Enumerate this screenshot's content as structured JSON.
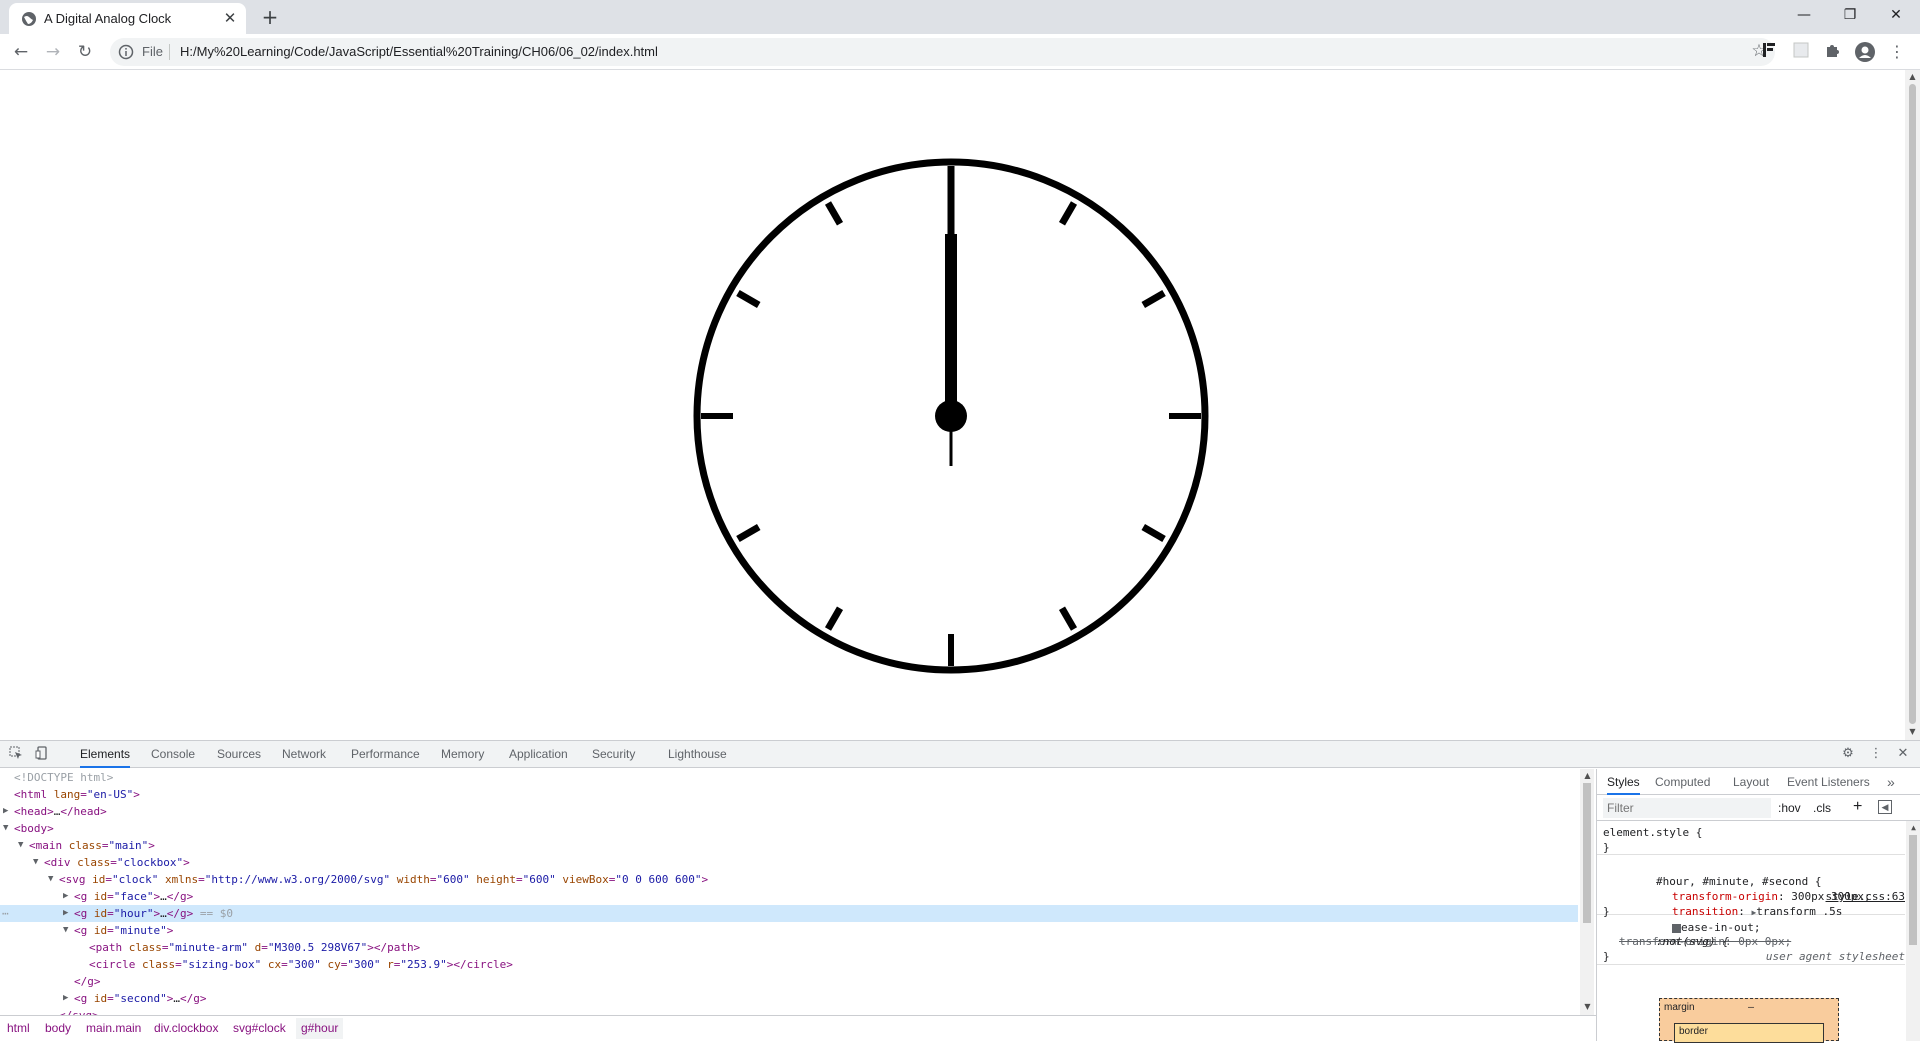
{
  "browser": {
    "tab_title": "A Digital Analog Clock",
    "new_tab_symbol": "+",
    "address_scheme": "File",
    "url": "H:/My%20Learning/Code/JavaScript/Essential%20Training/CH06/06_02/index.html"
  },
  "devtools": {
    "tabs": [
      "Elements",
      "Console",
      "Sources",
      "Network",
      "Performance",
      "Memory",
      "Application",
      "Security",
      "Lighthouse"
    ],
    "active_tab": "Elements",
    "dom_lines": [
      {
        "indent": 0,
        "html": "<span class='cm'>&lt;!DOCTYPE html&gt;</span>"
      },
      {
        "indent": 0,
        "html": "<span class='tg'>&lt;html</span> <span class='an'>lang</span><span class='tg'>=</span><span class='av'>\"en-US\"</span><span class='tg'>&gt;</span>"
      },
      {
        "indent": 0,
        "tri": "▶",
        "html": "<span class='tg'>&lt;head&gt;</span><span class='tx'>…</span><span class='tg'>&lt;/head&gt;</span>"
      },
      {
        "indent": 0,
        "tri": "▼",
        "html": "<span class='tg'>&lt;body&gt;</span>"
      },
      {
        "indent": 1,
        "tri": "▼",
        "html": "<span class='tg'>&lt;main</span> <span class='an'>class</span><span class='tg'>=</span><span class='av'>\"main\"</span><span class='tg'>&gt;</span>"
      },
      {
        "indent": 2,
        "tri": "▼",
        "html": "<span class='tg'>&lt;div</span> <span class='an'>class</span><span class='tg'>=</span><span class='av'>\"clockbox\"</span><span class='tg'>&gt;</span>"
      },
      {
        "indent": 3,
        "tri": "▼",
        "html": "<span class='tg'>&lt;svg</span> <span class='an'>id</span><span class='tg'>=</span><span class='av'>\"clock\"</span> <span class='an'>xmlns</span><span class='tg'>=</span><span class='av'>\"http://www.w3.org/2000/svg\"</span> <span class='an'>width</span><span class='tg'>=</span><span class='av'>\"600\"</span> <span class='an'>height</span><span class='tg'>=</span><span class='av'>\"600\"</span> <span class='an'>viewBox</span><span class='tg'>=</span><span class='av'>\"0 0 600 600\"</span><span class='tg'>&gt;</span>"
      },
      {
        "indent": 4,
        "tri": "▶",
        "html": "<span class='tg'>&lt;g</span> <span class='an'>id</span><span class='tg'>=</span><span class='av'>\"face\"</span><span class='tg'>&gt;</span><span class='tx'>…</span><span class='tg'>&lt;/g&gt;</span>"
      },
      {
        "indent": 4,
        "tri": "▶",
        "sel": true,
        "html": "<span class='tg'>&lt;g</span> <span class='an'>id</span><span class='tg'>=</span><span class='av'>\"hour\"</span><span class='tg'>&gt;</span><span class='tx'>…</span><span class='tg'>&lt;/g&gt;</span> <span class='cm'>== $0</span>"
      },
      {
        "indent": 4,
        "tri": "▼",
        "html": "<span class='tg'>&lt;g</span> <span class='an'>id</span><span class='tg'>=</span><span class='av'>\"minute\"</span><span class='tg'>&gt;</span>"
      },
      {
        "indent": 5,
        "html": "<span class='tg'>&lt;path</span> <span class='an'>class</span><span class='tg'>=</span><span class='av'>\"minute-arm\"</span> <span class='an'>d</span><span class='tg'>=</span><span class='av'>\"M300.5 298V67\"</span><span class='tg'>&gt;&lt;/path&gt;</span>"
      },
      {
        "indent": 5,
        "html": "<span class='tg'>&lt;circle</span> <span class='an'>class</span><span class='tg'>=</span><span class='av'>\"sizing-box\"</span> <span class='an'>cx</span><span class='tg'>=</span><span class='av'>\"300\"</span> <span class='an'>cy</span><span class='tg'>=</span><span class='av'>\"300\"</span> <span class='an'>r</span><span class='tg'>=</span><span class='av'>\"253.9\"</span><span class='tg'>&gt;&lt;/circle&gt;</span>"
      },
      {
        "indent": 4,
        "html": "<span class='tg'>&lt;/g&gt;</span>"
      },
      {
        "indent": 4,
        "tri": "▶",
        "html": "<span class='tg'>&lt;g</span> <span class='an'>id</span><span class='tg'>=</span><span class='av'>\"second\"</span><span class='tg'>&gt;</span><span class='tx'>…</span><span class='tg'>&lt;/g&gt;</span>"
      },
      {
        "indent": 3,
        "html": "<span class='tg'>&lt;/svg&gt;</span>"
      }
    ],
    "breadcrumbs": [
      "html",
      "body",
      "main.main",
      "div.clockbox",
      "svg#clock",
      "g#hour"
    ],
    "styles_panel": {
      "tabs": [
        "Styles",
        "Computed",
        "Layout",
        "Event Listeners"
      ],
      "more_tabs": "»",
      "filter_placeholder": "Filter",
      "hov": ":hov",
      "cls": ".cls",
      "add": "+",
      "rule1_selector": "element.style {",
      "rule1_close": "}",
      "rule2_selector": "#hour, #minute, #second {",
      "rule2_source": "style.css:63",
      "rule2_prop1": "transform-origin",
      "rule2_val1": "300px 300px;",
      "rule2_prop2": "transition",
      "rule2_val2": "transform .5s",
      "rule2_val2b": "ease-in-out;",
      "rule2_close": "}",
      "rule3_selector": ":not(svg) {",
      "rule3_source": "user agent stylesheet",
      "rule3_prop": "transform-origin: 0px 0px;",
      "rule3_close": "}",
      "box_margin_label": "margin",
      "box_margin_value": "–",
      "box_border_label": "border"
    }
  },
  "clock": {
    "hour_hand_angle_deg": 0,
    "minute_hand_angle_deg": 0,
    "color": "#000000"
  }
}
